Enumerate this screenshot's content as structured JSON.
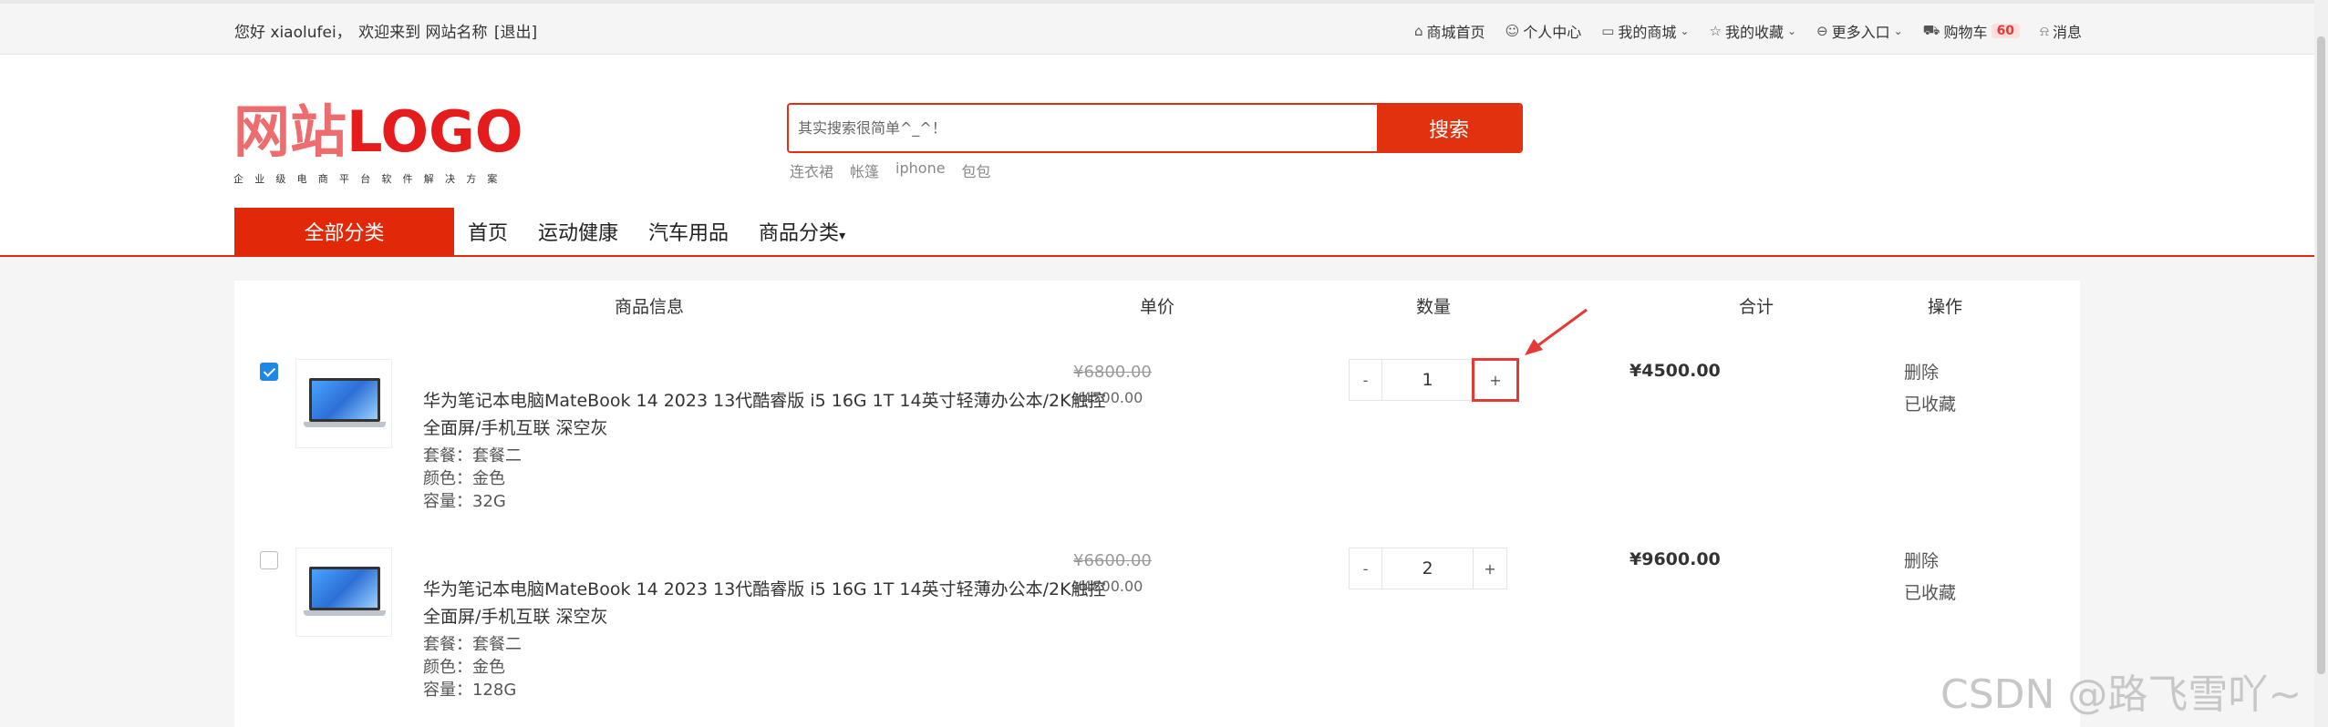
{
  "topbar": {
    "greeting": "您好 xiaolufei，",
    "welcome": "欢迎来到 网站名称",
    "logout": "[退出]",
    "nav": [
      {
        "icon": "home-icon",
        "label": "商城首页"
      },
      {
        "icon": "user-icon",
        "label": "个人中心"
      },
      {
        "icon": "shop-icon",
        "label": "我的商城"
      },
      {
        "icon": "star-icon",
        "label": "我的收藏"
      },
      {
        "icon": "more-icon",
        "label": "更多入口"
      },
      {
        "icon": "cart-icon",
        "label": "购物车"
      },
      {
        "icon": "bell-icon",
        "label": "消息"
      }
    ],
    "cart_count": "60"
  },
  "logo": {
    "cn": "网站",
    "en": "LOGO",
    "sub": "企业级电商平台软件解决方案"
  },
  "search": {
    "placeholder": "其实搜索很简单^_^！",
    "button": "搜索",
    "hot": [
      "连衣裙",
      "帐篷",
      "iphone",
      "包包"
    ]
  },
  "nav": {
    "category": "全部分类",
    "items": [
      "首页",
      "运动健康",
      "汽车用品",
      "商品分类"
    ]
  },
  "cart": {
    "headers": {
      "info": "商品信息",
      "price": "单价",
      "qty": "数量",
      "total": "合计",
      "ops": "操作"
    },
    "rows": [
      {
        "checked": true,
        "name": "华为笔记本电脑MateBook 14 2023 13代酷睿版 i5 16G 1T 14英寸轻薄办公本/2K触控全面屏/手机互联 深空灰",
        "spec1": "套餐：套餐二",
        "spec2": "颜色：金色",
        "spec3": "容量：32G",
        "old_price": "¥6800.00",
        "price": "¥4500.00",
        "minus": "-",
        "qty": "1",
        "plus": "+",
        "total": "¥4500.00",
        "delete": "删除",
        "fav": "已收藏"
      },
      {
        "checked": false,
        "name": "华为笔记本电脑MateBook 14 2023 13代酷睿版 i5 16G 1T 14英寸轻薄办公本/2K触控全面屏/手机互联 深空灰",
        "spec1": "套餐：套餐二",
        "spec2": "颜色：金色",
        "spec3": "容量：128G",
        "old_price": "¥6600.00",
        "price": "¥4800.00",
        "minus": "-",
        "qty": "2",
        "plus": "+",
        "total": "¥9600.00",
        "delete": "删除",
        "fav": "已收藏"
      }
    ]
  },
  "watermark": "CSDN @路飞雪吖~",
  "colors": {
    "brand_red": "#e2310e",
    "highlight_red": "#e53935",
    "checkbox_blue": "#1e88e5"
  }
}
